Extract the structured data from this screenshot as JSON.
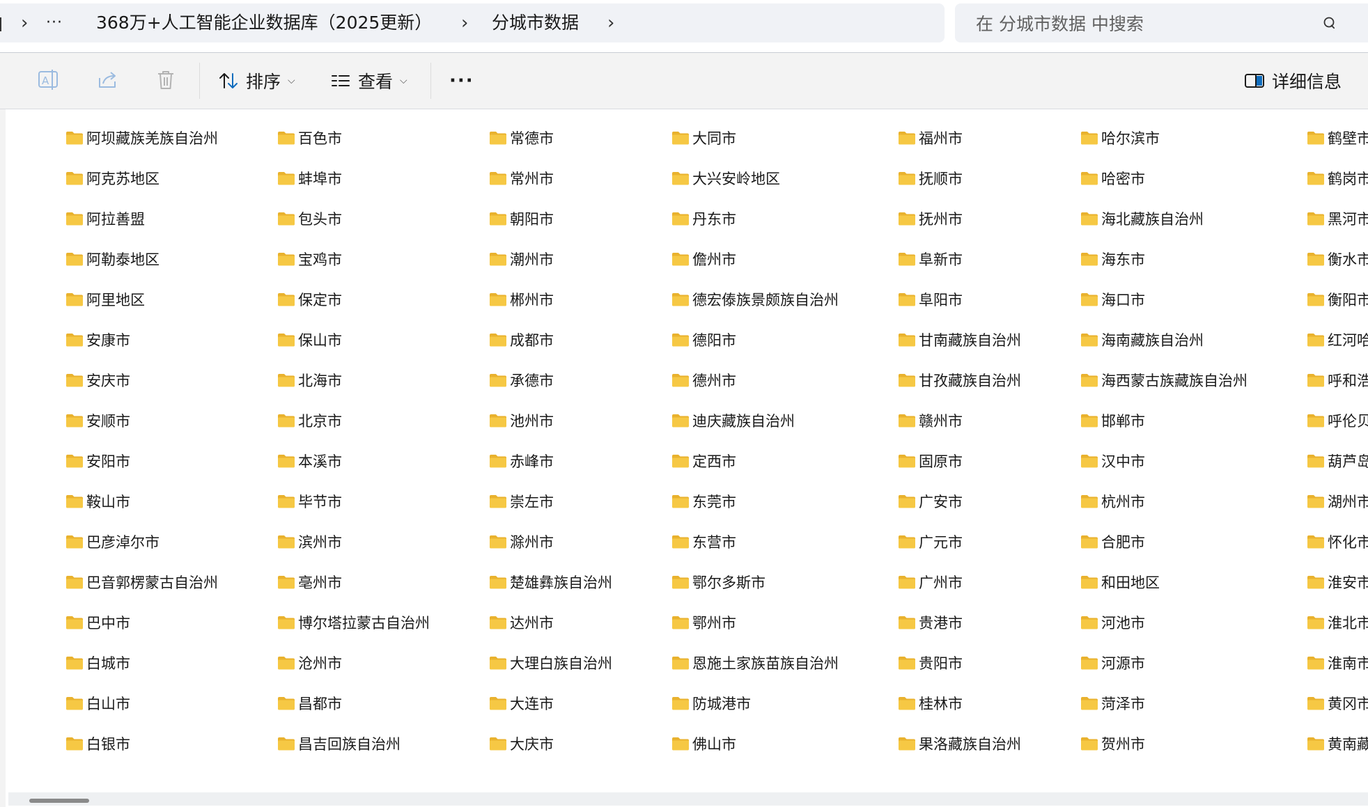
{
  "breadcrumb": {
    "overflow": "···",
    "items": [
      "368万+人工智能企业数据库（2025更新）",
      "分城市数据"
    ]
  },
  "search": {
    "placeholder": "在 分城市数据 中搜索",
    "value": ""
  },
  "toolbar": {
    "icons": [
      "rename-icon",
      "share-icon",
      "delete-icon"
    ],
    "sort_label": "排序",
    "view_label": "查看",
    "more_label": "···",
    "details_label": "详细信息"
  },
  "folders": {
    "columns": [
      [
        "阿坝藏族羌族自治州",
        "阿克苏地区",
        "阿拉善盟",
        "阿勒泰地区",
        "阿里地区",
        "安康市",
        "安庆市",
        "安顺市",
        "安阳市",
        "鞍山市",
        "巴彦淖尔市",
        "巴音郭楞蒙古自治州",
        "巴中市",
        "白城市",
        "白山市",
        "白银市"
      ],
      [
        "百色市",
        "蚌埠市",
        "包头市",
        "宝鸡市",
        "保定市",
        "保山市",
        "北海市",
        "北京市",
        "本溪市",
        "毕节市",
        "滨州市",
        "亳州市",
        "博尔塔拉蒙古自治州",
        "沧州市",
        "昌都市",
        "昌吉回族自治州"
      ],
      [
        "常德市",
        "常州市",
        "朝阳市",
        "潮州市",
        "郴州市",
        "成都市",
        "承德市",
        "池州市",
        "赤峰市",
        "崇左市",
        "滁州市",
        "楚雄彝族自治州",
        "达州市",
        "大理白族自治州",
        "大连市",
        "大庆市"
      ],
      [
        "大同市",
        "大兴安岭地区",
        "丹东市",
        "儋州市",
        "德宏傣族景颇族自治州",
        "德阳市",
        "德州市",
        "迪庆藏族自治州",
        "定西市",
        "东莞市",
        "东营市",
        "鄂尔多斯市",
        "鄂州市",
        "恩施土家族苗族自治州",
        "防城港市",
        "佛山市"
      ],
      [
        "福州市",
        "抚顺市",
        "抚州市",
        "阜新市",
        "阜阳市",
        "甘南藏族自治州",
        "甘孜藏族自治州",
        "赣州市",
        "固原市",
        "广安市",
        "广元市",
        "广州市",
        "贵港市",
        "贵阳市",
        "桂林市",
        "果洛藏族自治州"
      ],
      [
        "哈尔滨市",
        "哈密市",
        "海北藏族自治州",
        "海东市",
        "海口市",
        "海南藏族自治州",
        "海西蒙古族藏族自治州",
        "邯郸市",
        "汉中市",
        "杭州市",
        "合肥市",
        "和田地区",
        "河池市",
        "河源市",
        "菏泽市",
        "贺州市"
      ],
      [
        "鹤壁市",
        "鹤岗市",
        "黑河市",
        "衡水市",
        "衡阳市",
        "红河哈",
        "呼和浩",
        "呼伦贝",
        "葫芦岛",
        "湖州市",
        "怀化市",
        "淮安市",
        "淮北市",
        "淮南市",
        "黄冈市",
        "黄南藏"
      ]
    ]
  },
  "colors": {
    "folder": "#f6c844",
    "folder_dark": "#e9b22e",
    "accent": "#0f6cbd"
  }
}
